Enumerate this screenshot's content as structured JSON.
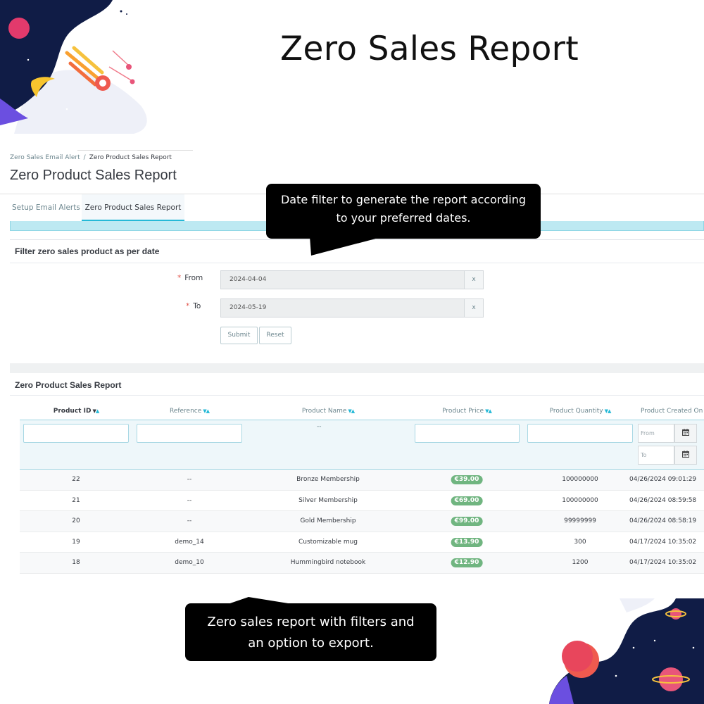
{
  "hero": {
    "title": "Zero Sales Report"
  },
  "breadcrumb": {
    "parent": "Zero Sales Email Alert",
    "separator": "/",
    "current": "Zero Product Sales Report"
  },
  "page_title": "Zero Product Sales Report",
  "tabs": [
    {
      "label": "Setup Email Alerts",
      "active": false
    },
    {
      "label": "Zero Product Sales Report",
      "active": true
    }
  ],
  "callouts": {
    "date_filter": {
      "line1": "Date filter to generate the report according",
      "line2": "to your preferred dates."
    },
    "report": {
      "line1": "Zero sales report with filters and",
      "line2": "an option to export."
    }
  },
  "filter_panel": {
    "heading": "Filter zero sales product as per date",
    "from": {
      "required_mark": "*",
      "label": "From",
      "value": "2024-04-04",
      "clear": "x"
    },
    "to": {
      "required_mark": "*",
      "label": "To",
      "value": "2024-05-19",
      "clear": "x"
    },
    "submit_label": "Submit",
    "reset_label": "Reset"
  },
  "report_panel": {
    "heading": "Zero Product Sales Report",
    "columns": [
      "Product ID",
      "Reference",
      "Product Name",
      "Product Price",
      "Product Quantity",
      "Product Created On"
    ],
    "filters": {
      "product_name_placeholder": "--",
      "created_from_placeholder": "From",
      "created_to_placeholder": "To",
      "calendar_icon": "calendar-icon"
    },
    "rows": [
      {
        "id": "22",
        "reference": "--",
        "name": "Bronze Membership",
        "price": "€39.00",
        "quantity": "100000000",
        "created": "04/26/2024 09:01:29"
      },
      {
        "id": "21",
        "reference": "--",
        "name": "Silver Membership",
        "price": "€69.00",
        "quantity": "100000000",
        "created": "04/26/2024 08:59:58"
      },
      {
        "id": "20",
        "reference": "--",
        "name": "Gold Membership",
        "price": "€99.00",
        "quantity": "99999999",
        "created": "04/26/2024 08:58:19"
      },
      {
        "id": "19",
        "reference": "demo_14",
        "name": "Customizable mug",
        "price": "€13.90",
        "quantity": "300",
        "created": "04/17/2024 10:35:02"
      },
      {
        "id": "18",
        "reference": "demo_10",
        "name": "Hummingbird notebook",
        "price": "€12.90",
        "quantity": "1200",
        "created": "04/17/2024 10:35:02"
      }
    ]
  },
  "colors": {
    "accent": "#25b9d7",
    "price_badge": "#70b580",
    "callout_bg": "#000000",
    "deco_navy": "#101c46",
    "deco_purple": "#6b4fe0"
  }
}
